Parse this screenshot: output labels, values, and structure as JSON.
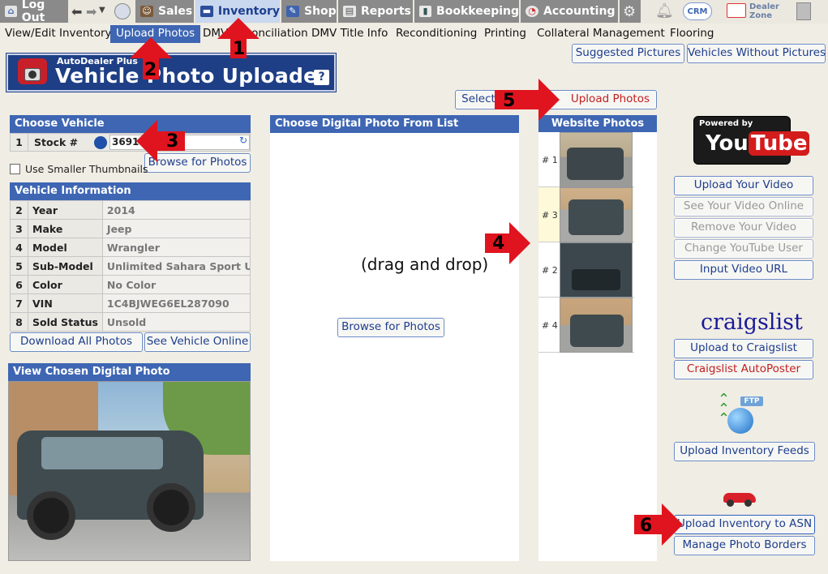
{
  "topnav": {
    "logout": "Log Out",
    "sales": "Sales",
    "inventory": "Inventory",
    "shop": "Shop",
    "reports": "Reports",
    "bookkeeping": "Bookkeeping",
    "accounting": "Accounting",
    "crm": "CRM",
    "dealer_zone": "Dealer Zone"
  },
  "subnav": {
    "items": [
      "View/Edit Inventory",
      "Upload Photos",
      "DMV Reconciliation",
      "DMV Title Info",
      "Reconditioning",
      "Printing",
      "Collateral Management",
      "Flooring"
    ]
  },
  "header": {
    "brand_small": "AutoDealer Plus",
    "title": "Vehicle Photo Uploader",
    "help": "?"
  },
  "top_buttons": {
    "suggested": "Suggested Pictures",
    "without": "Vehicles Without Pictures"
  },
  "choose_vehicle": {
    "title": "Choose Vehicle",
    "row_num": "1",
    "label": "Stock #",
    "value": "3691",
    "browse": "Browse for Photos",
    "smaller_thumbs": "Use Smaller Thumbnails"
  },
  "vehicle_info": {
    "title": "Vehicle Information",
    "rows": [
      {
        "n": "2",
        "k": "Year",
        "v": "2014"
      },
      {
        "n": "3",
        "k": "Make",
        "v": "Jeep"
      },
      {
        "n": "4",
        "k": "Model",
        "v": "Wrangler"
      },
      {
        "n": "5",
        "k": "Sub-Model",
        "v": "Unlimited Sahara Sport Utili"
      },
      {
        "n": "6",
        "k": "Color",
        "v": "No Color"
      },
      {
        "n": "7",
        "k": "VIN",
        "v": "1C4BJWEG6EL287090"
      },
      {
        "n": "8",
        "k": "Sold Status",
        "v": "Unsold"
      }
    ],
    "download_all": "Download All Photos",
    "see_online": "See Vehicle Online"
  },
  "chosen_photo": {
    "title": "View Chosen Digital Photo"
  },
  "digital_list": {
    "title": "Choose Digital Photo From List",
    "drag_text": "(drag and drop)",
    "browse": "Browse for Photos"
  },
  "actions": {
    "select": "Select",
    "upload": "Upload Photos"
  },
  "website_photos": {
    "title": "Website Photos",
    "items": [
      "# 1",
      "# 3",
      "# 2",
      "# 4"
    ]
  },
  "youtube": {
    "powered": "Powered by",
    "you": "You",
    "tube": "Tube",
    "upload": "Upload Your Video",
    "see": "See Your Video Online",
    "remove": "Remove Your Video",
    "change": "Change YouTube User",
    "input_url": "Input Video URL"
  },
  "craigslist": {
    "logo": "craigslist",
    "upload": "Upload to Craigslist",
    "autoposter": "Craigslist AutoPoster"
  },
  "feeds": {
    "ftp": "FTP",
    "upload": "Upload Inventory Feeds"
  },
  "asn": {
    "upload": "Upload Inventory to ASN",
    "borders": "Manage Photo Borders"
  },
  "annotations": [
    "1",
    "2",
    "3",
    "4",
    "5",
    "6"
  ],
  "colors": {
    "nav_active": "#c9d7ef",
    "header_blue": "#3e66b3",
    "arrow_red": "#e0141e",
    "button_text": "#1d3d8e"
  }
}
